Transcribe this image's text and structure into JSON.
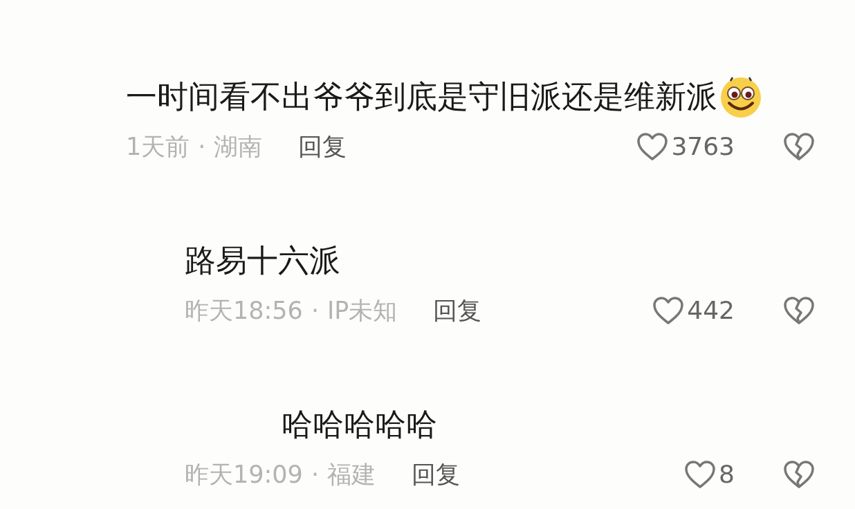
{
  "comments": [
    {
      "text": "一时间看不出爷爷到底是守旧派还是维新派",
      "emoji": true,
      "time": "1天前",
      "separator": "·",
      "location": "湖南",
      "reply": "回复",
      "likes": "3763",
      "children": [
        {
          "text": "路易十六派",
          "emoji": false,
          "time": "昨天18:56",
          "separator": "·",
          "location": "IP未知",
          "reply": "回复",
          "likes": "442",
          "children": [
            {
              "text": "哈哈哈哈哈",
              "emoji": false,
              "time": "昨天19:09",
              "separator": "·",
              "location": "福建",
              "reply": "回复",
              "likes": "8"
            }
          ]
        }
      ]
    }
  ]
}
